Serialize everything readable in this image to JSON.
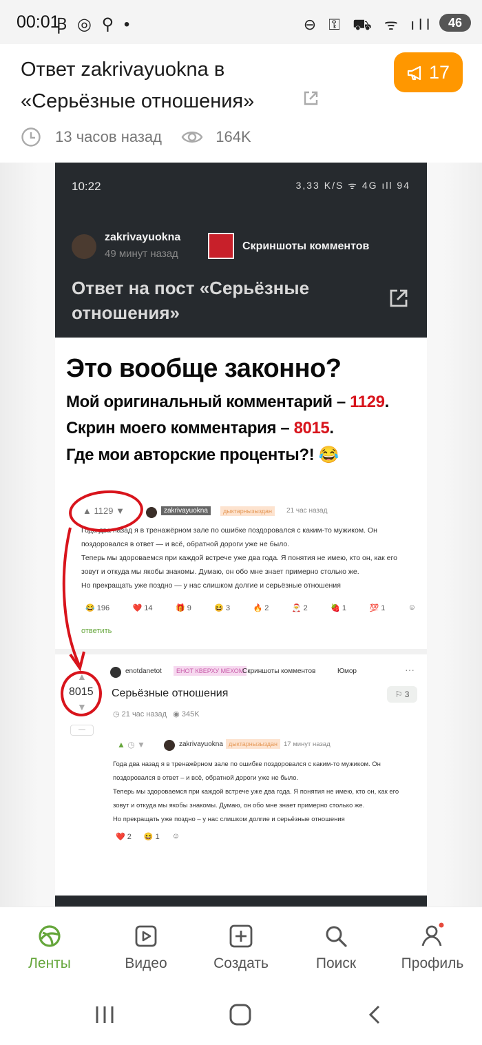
{
  "status_bar": {
    "time": "00:01",
    "left_icons": "Ꞵ ◎ ⚲ •",
    "battery": "46"
  },
  "header": {
    "title": "Ответ zakrivayuokna в «Серьёзные отношения»",
    "comments_count": "17",
    "time_ago": "13 часов назад",
    "views": "164K"
  },
  "phone_screenshot": {
    "time": "10:22",
    "status": "3,33 K/S  ᯤ 4G ıll 94",
    "author": "zakrivayuokna",
    "author_time": "49 минут назад",
    "community": "Скриншоты комментов",
    "post_title": "Ответ на пост «Серьёзные отношения»"
  },
  "meme": {
    "headline": "Это вообще законно?",
    "line1_text": "Мой оригинальный комментарий – ",
    "line1_num": "1129",
    "line2_text": "Скрин моего комментария – ",
    "line2_num": "8015",
    "line3_text": "Где мои авторские проценты?! 😂"
  },
  "comment1": {
    "score": "1129",
    "author": "zakrivayuokna",
    "tag": "дыктарнызыздан",
    "time": "21 час назад",
    "text_lines": [
      "Года два назад я в тренажёрном зале по ошибке поздоровался с каким-то мужиком. Он",
      "поздоровался в ответ — и всё, обратной дороги уже не было.",
      "Теперь мы здороваемся при каждой встрече уже два года. Я понятия не имею, кто он, как его",
      "зовут и откуда мы якобы знакомы. Думаю, он обо мне знает примерно столько же.",
      "Но прекращать уже поздно — у нас слишком долгие и серьёзные отношения"
    ],
    "reactions": [
      "😂 196",
      "❤️ 14",
      "🎁 9",
      "😆 3",
      "🔥 2",
      "🎅 2",
      "🍓 1",
      "💯 1",
      "☺"
    ],
    "reply": "ответить"
  },
  "post2": {
    "score": "8015",
    "author": "enotdanetot",
    "tag": "ЕНОТ КВЕРХУ МЕХОМ",
    "community1": "Скриншоты комментов",
    "community2": "Юмор",
    "title": "Серьёзные отношения",
    "comments": "3",
    "time": "21 час назад",
    "views": "345K",
    "inner_author": "zakrivayuokna",
    "inner_tag": "дыктарнызыздан",
    "inner_time": "17 минут назад",
    "inner_text": [
      "Года два назад я в тренажёрном зале по ошибке поздоровался с каким-то мужиком. Он",
      "поздоровался в ответ – и всё, обратной дороги уже не было.",
      "Теперь мы здороваемся при каждой встрече уже два года. Я понятия не имею, кто он, как его",
      "зовут и откуда мы якобы знакомы. Думаю, он обо мне знает примерно столько же.",
      "Но прекращать уже поздно – у нас слишком долгие и серьёзные отношения"
    ],
    "inner_reactions": [
      "❤️ 2",
      "😆 1",
      "☺"
    ]
  },
  "nav": {
    "items": [
      {
        "label": "Ленты",
        "icon": "feed-icon",
        "active": true
      },
      {
        "label": "Видео",
        "icon": "video-icon"
      },
      {
        "label": "Создать",
        "icon": "create-icon"
      },
      {
        "label": "Поиск",
        "icon": "search-icon"
      },
      {
        "label": "Профиль",
        "icon": "profile-icon"
      }
    ]
  },
  "colors": {
    "accent": "#65a63b",
    "badge": "#ff9700",
    "red": "#d8141c"
  }
}
